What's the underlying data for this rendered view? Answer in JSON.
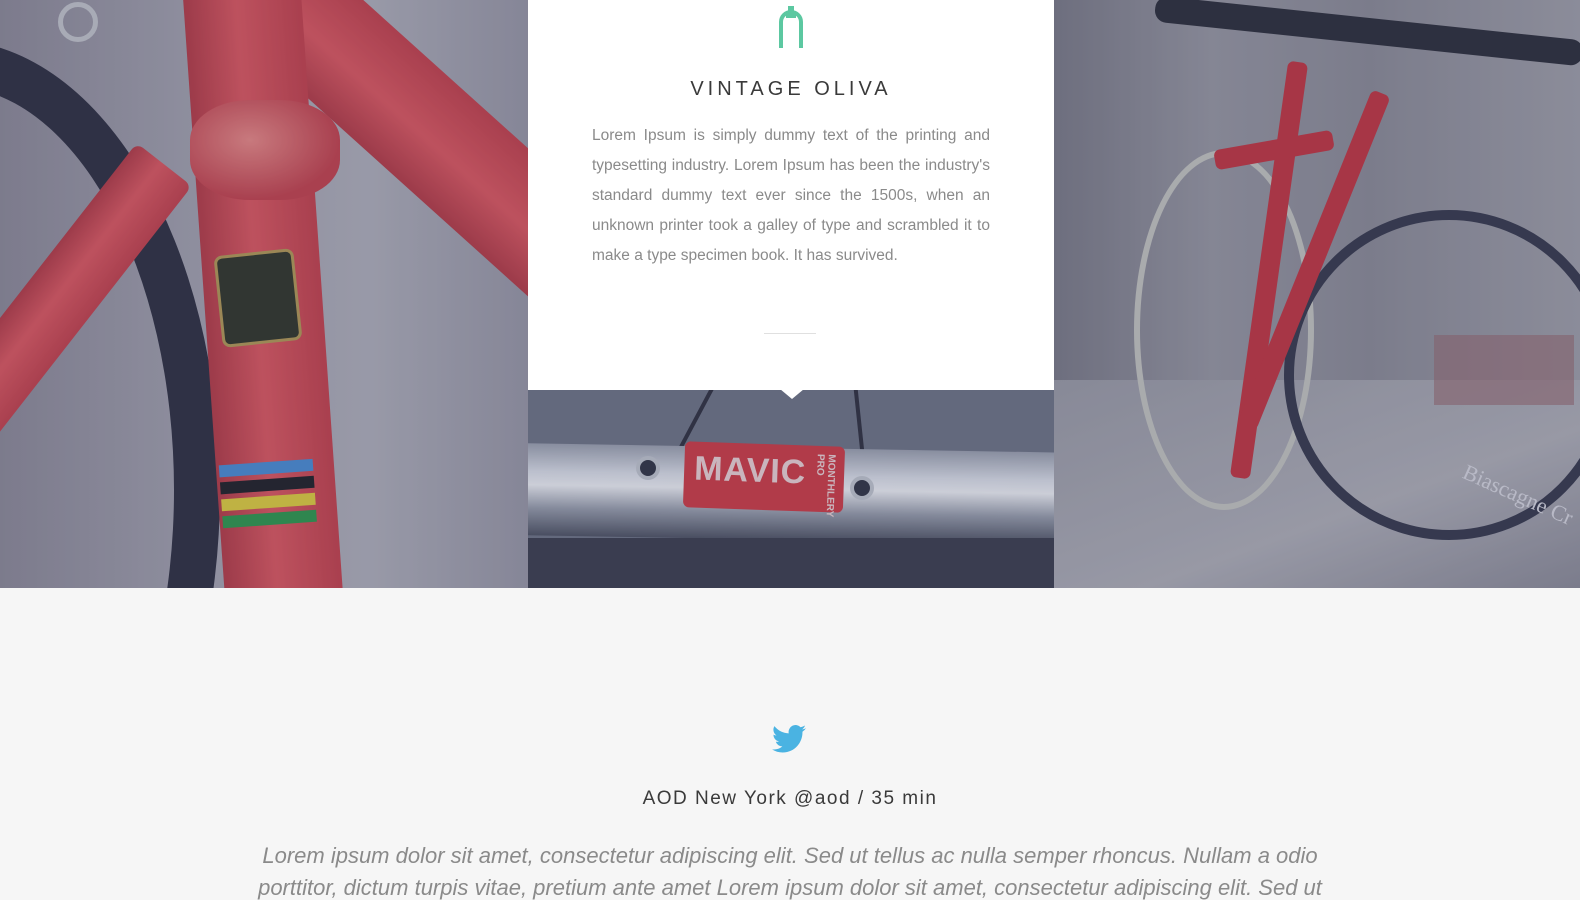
{
  "card": {
    "title": "VINTAGE OLIVA",
    "body": "Lorem Ipsum is simply dummy text of the printing and typesetting industry. Lorem Ipsum has been the industry's standard dummy text ever since the 1500s, when an unknown printer took a galley of type and scrambled it to make a type specimen book. It has survived.",
    "icon": "bike-fork-icon",
    "accent_color": "#5cc8a1"
  },
  "photos": {
    "left_icon": "bike-frame-photo",
    "mid_rim_label": "MAVIC",
    "mid_rim_small": "MONTHLERY PRO",
    "right_wall_text": "Biascagne Cr"
  },
  "tweet": {
    "icon": "twitter-icon",
    "icon_color": "#4ab3e2",
    "meta": "AOD New York @aod / 35 min",
    "text": "Lorem ipsum dolor sit amet, consectetur adipiscing elit. Sed ut tellus ac nulla semper rhoncus. Nullam a odio porttitor, dictum turpis vitae, pretium ante amet Lorem ipsum dolor sit amet, consectetur adipiscing elit. Sed ut"
  }
}
